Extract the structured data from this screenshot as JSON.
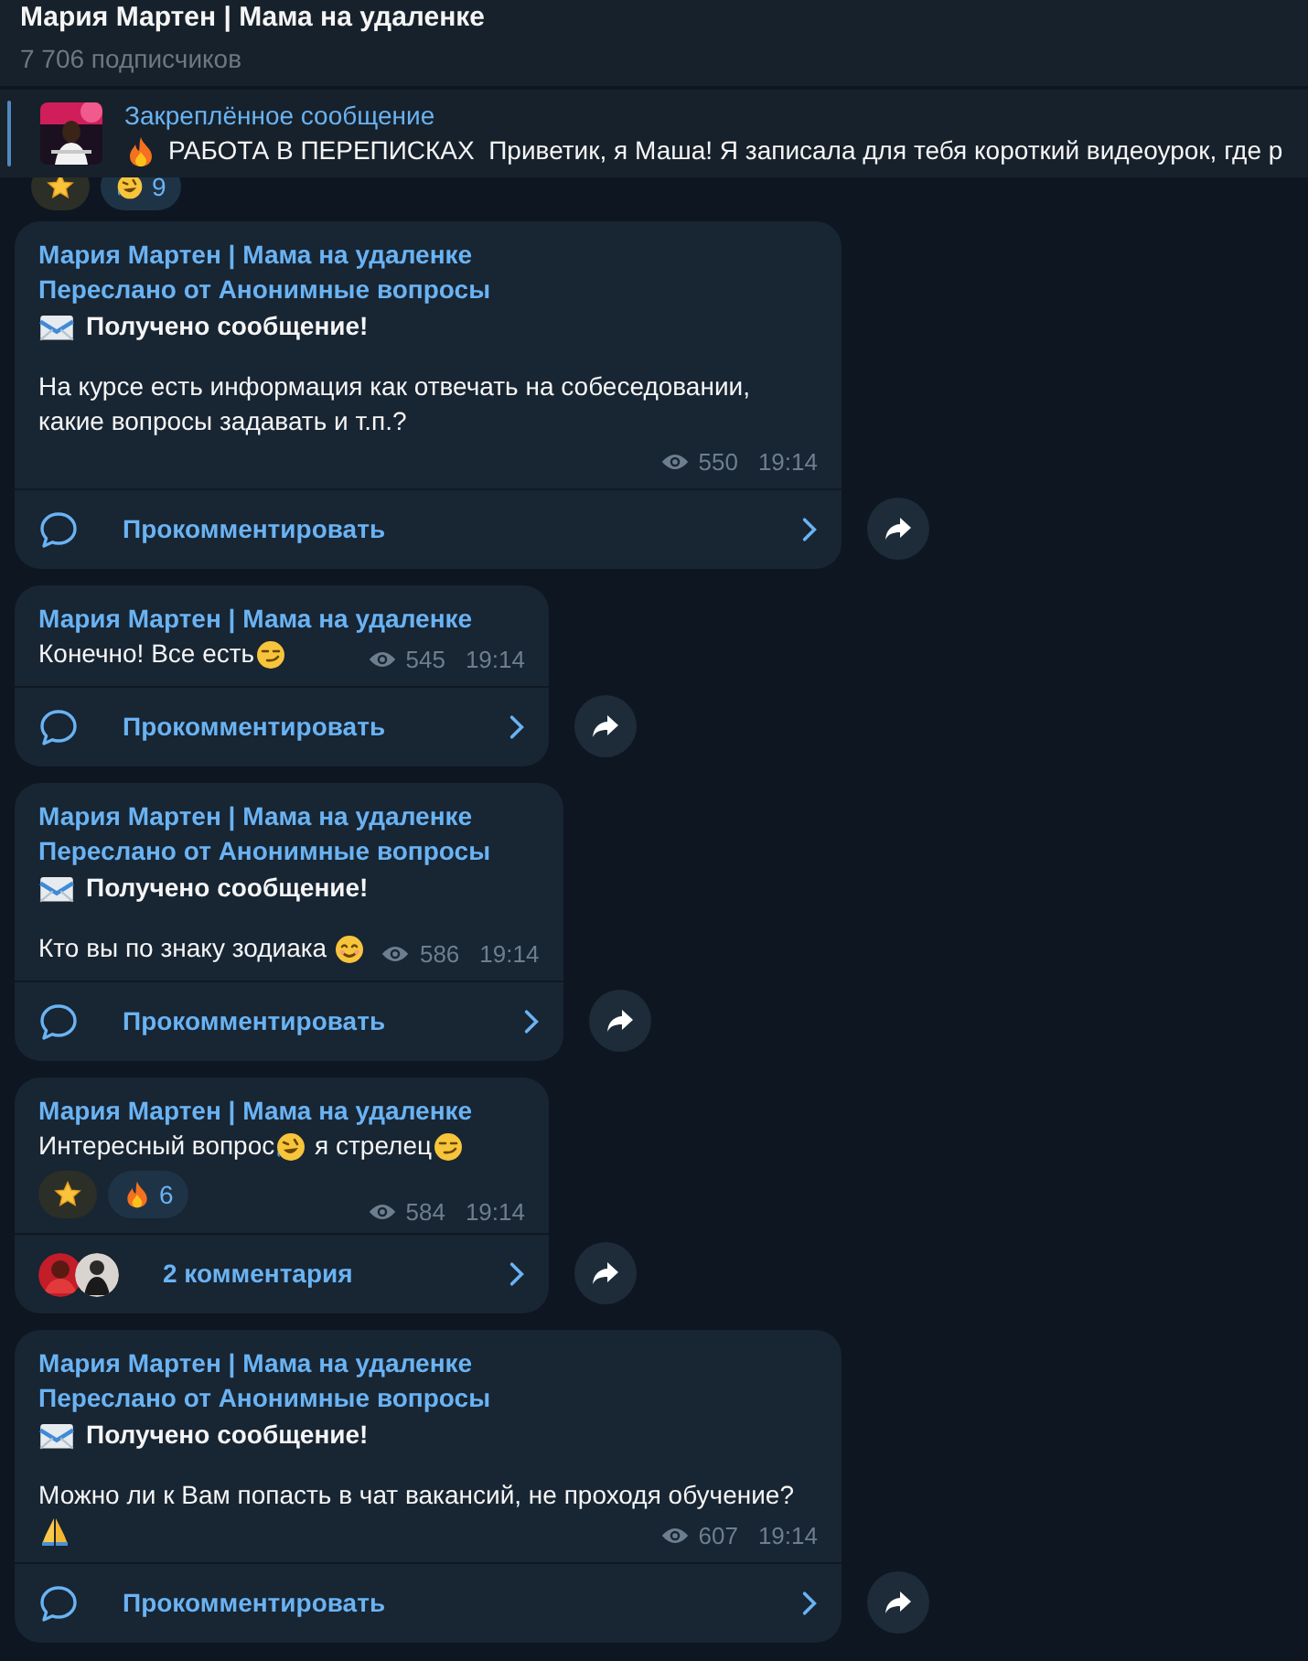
{
  "header": {
    "title": "Мария Мартен | Мама на удаленке",
    "subtitle": "7 706 подписчиков"
  },
  "pinned": {
    "label": "Закреплённое сообщение",
    "parts": [
      {
        "kind": "fire"
      },
      {
        "kind": "text",
        "text": "РАБОТА В ПЕРЕПИСКАХ  Приветик, я Маша! Я записала для тебя короткий видеоурок, где р"
      }
    ]
  },
  "partial_reactions": [
    {
      "kind": "star"
    },
    {
      "kind": "rofl",
      "count": "9"
    }
  ],
  "messages": [
    {
      "author": "Мария Мартен | Мама на удаленке",
      "forwarded": "Переслано от Анонимные вопросы",
      "received": "Получено сообщение!",
      "body": [
        {
          "kind": "text",
          "text": "На курсе есть информация как отвечать на собеседовании, какие вопросы задавать и т.п.?"
        }
      ],
      "views": "550",
      "time": "19:14",
      "comments": {
        "kind": "prompt",
        "text": "Прокомментировать"
      }
    },
    {
      "author": "Мария Мартен | Мама на удаленке",
      "body": [
        {
          "kind": "text",
          "text": "Конечно! Все есть"
        },
        {
          "kind": "smirk"
        }
      ],
      "views": "545",
      "time": "19:14",
      "comments": {
        "kind": "prompt",
        "text": "Прокомментировать"
      }
    },
    {
      "author": "Мария Мартен | Мама на удаленке",
      "forwarded": "Переслано от Анонимные вопросы",
      "received": "Получено сообщение!",
      "body": [
        {
          "kind": "text",
          "text": "Кто вы по знаку зодиака "
        },
        {
          "kind": "smile"
        }
      ],
      "views": "586",
      "time": "19:14",
      "comments": {
        "kind": "prompt",
        "text": "Прокомментировать"
      }
    },
    {
      "author": "Мария Мартен | Мама на удаленке",
      "body": [
        {
          "kind": "text",
          "text": "Интересный вопрос"
        },
        {
          "kind": "rofl"
        },
        {
          "kind": "text",
          "text": " я стрелец"
        },
        {
          "kind": "smirk"
        }
      ],
      "reactions": [
        {
          "kind": "star"
        },
        {
          "kind": "fire",
          "count": "6"
        }
      ],
      "views": "584",
      "time": "19:14",
      "comments": {
        "kind": "count",
        "text": "2 комментария"
      }
    },
    {
      "author": "Мария Мартен | Мама на удаленке",
      "forwarded": "Переслано от Анонимные вопросы",
      "received": "Получено сообщение!",
      "body": [
        {
          "kind": "text",
          "text": "Можно ли к Вам попасть в чат вакансий, не проходя обучение? "
        },
        {
          "kind": "pray"
        }
      ],
      "views": "607",
      "time": "19:14",
      "comments": {
        "kind": "prompt",
        "text": "Прокомментировать"
      }
    }
  ]
}
